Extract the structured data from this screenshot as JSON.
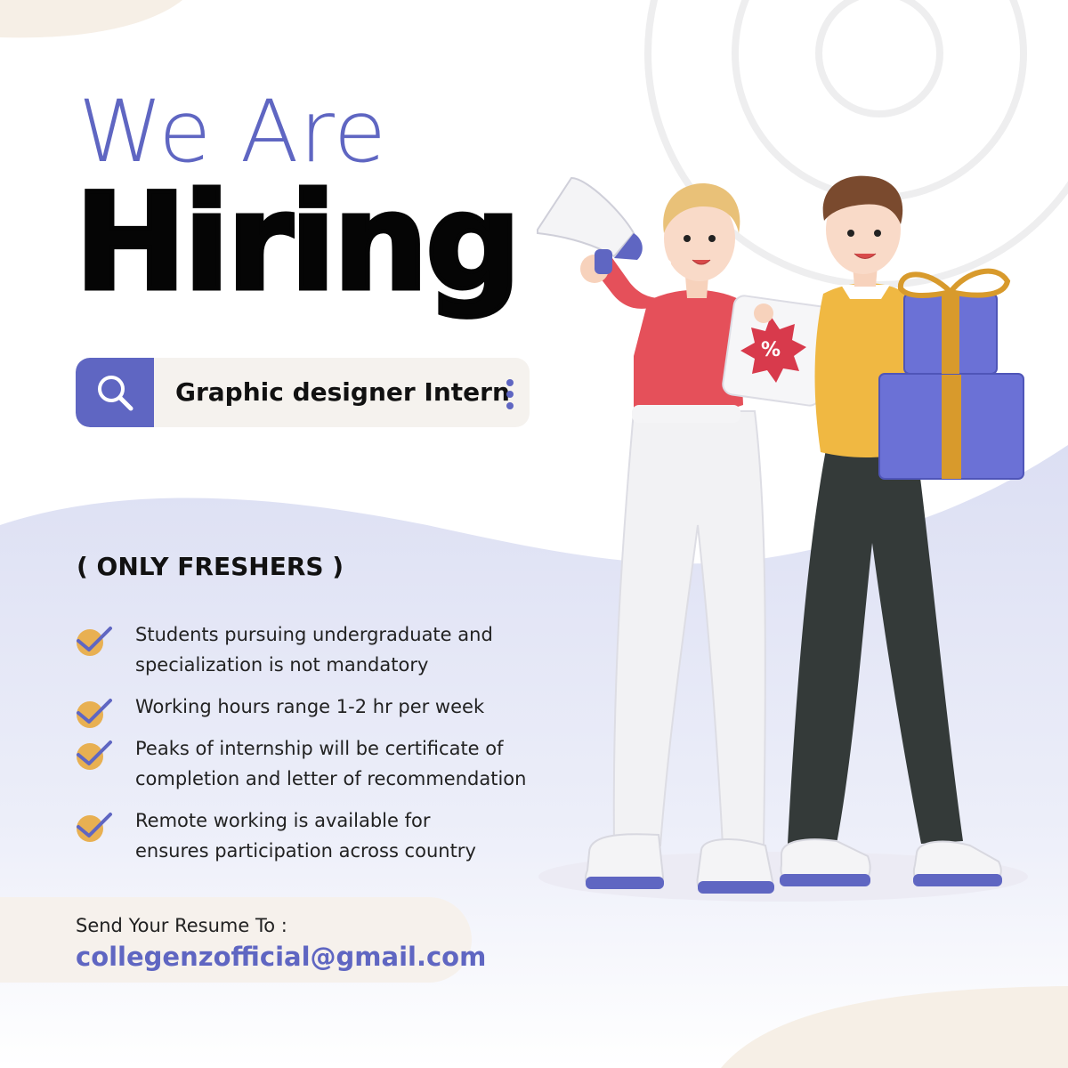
{
  "headline": {
    "line1": "We Are",
    "line2": "Hiring"
  },
  "search": {
    "query": "Graphic designer Intern",
    "icon": "search-icon",
    "menu_icon": "more-vertical-icon"
  },
  "eligibility": "( ONLY FRESHERS )",
  "requirements": [
    {
      "text": "Students pursuing undergraduate and\nspecialization is not mandatory",
      "icon": "check-icon"
    },
    {
      "text": "Working hours range 1-2 hr per week",
      "icon": "check-icon"
    },
    {
      "text": "Peaks of internship will be certificate of\ncompletion and letter of recommendation",
      "icon": "check-icon"
    },
    {
      "text": "Remote working is available for\nensures participation across country",
      "icon": "check-icon"
    }
  ],
  "contact": {
    "label": "Send Your Resume To :",
    "email": "collegenzofficial@gmail.com"
  },
  "illustration": {
    "badge_symbol": "%"
  },
  "colors": {
    "accent": "#5f66c2",
    "text_dark": "#111111",
    "check_circle": "#e8b052",
    "cream": "#f6f1ec",
    "lavender": "#e7e8f6"
  }
}
